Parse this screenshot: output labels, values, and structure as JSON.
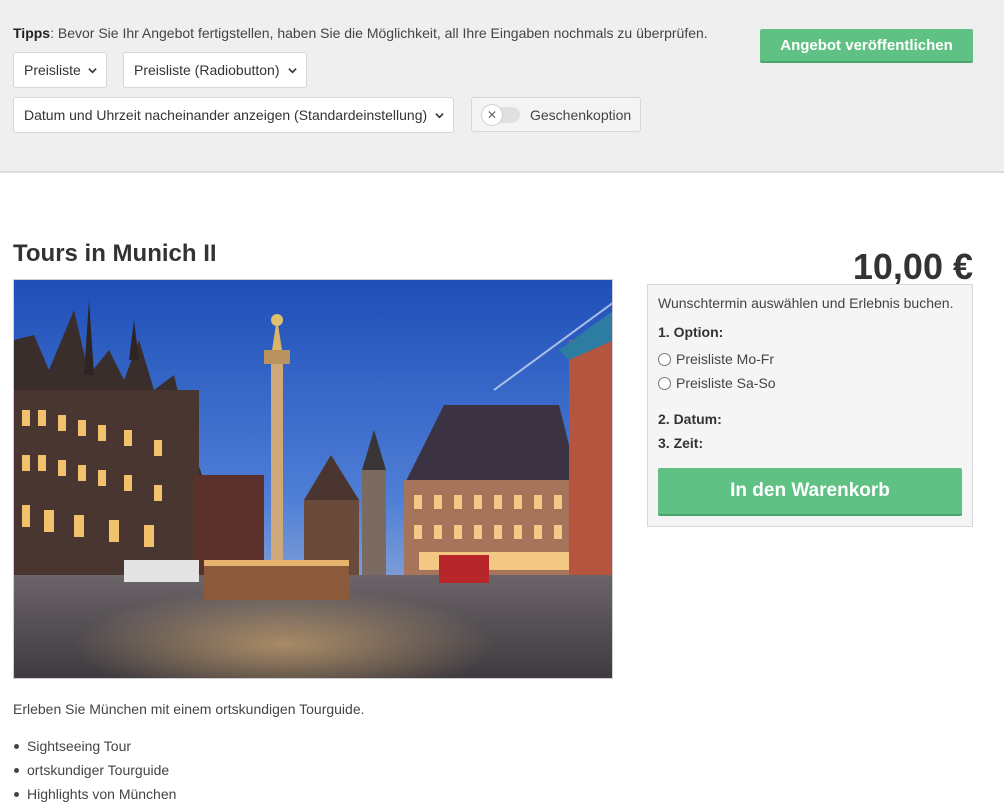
{
  "toolbar": {
    "tips_label": "Tipps",
    "tips_text": ": Bevor Sie Ihr Angebot fertigstellen, haben Sie die Möglichkeit, all Ihre Eingaben nochmals zu überprüfen.",
    "select_price_mode": "Preisliste",
    "select_price_display": "Preisliste (Radiobutton)",
    "select_date_time": "Datum und Uhrzeit nacheinander anzeigen (Standardeinstellung)",
    "gift_option_label": "Geschenkoption",
    "gift_option_enabled": false,
    "publish_label": "Angebot veröffentlichen"
  },
  "product": {
    "title": "Tours in Munich II",
    "image_alt": "Marienplatz München bei Nacht",
    "description": "Erleben Sie München mit einem ortskundigen Tourguide.",
    "features": [
      "Sightseeing Tour",
      "ortskundiger Tourguide",
      "Highlights von München"
    ]
  },
  "booking": {
    "price": "10,00 €",
    "intro": "Wunschtermin auswählen und Erlebnis buchen.",
    "option_label": "1. Option:",
    "options": [
      "Preisliste Mo-Fr",
      "Preisliste Sa-So"
    ],
    "date_label": "2. Datum:",
    "time_label": "3. Zeit:",
    "cart_label": "In den Warenkorb"
  },
  "colors": {
    "accent_green": "#5fc184",
    "toolbar_bg": "#efefef",
    "booking_bg": "#f5f5f5"
  },
  "icons": [
    "chevron-down-icon",
    "toggle-off-icon",
    "radio-icon"
  ]
}
